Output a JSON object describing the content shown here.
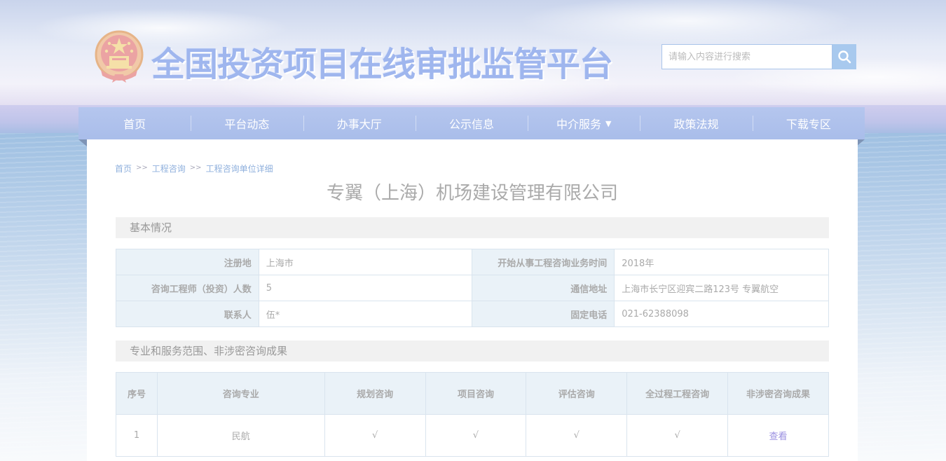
{
  "header": {
    "site_title": "全国投资项目在线审批监管平台",
    "emblem_icon": "national-emblem-icon",
    "search": {
      "placeholder": "请输入内容进行搜索",
      "icon": "search-icon"
    }
  },
  "nav": {
    "items": [
      {
        "label": "首页"
      },
      {
        "label": "平台动态"
      },
      {
        "label": "办事大厅"
      },
      {
        "label": "公示信息"
      },
      {
        "label": "中介服务",
        "caret": "▼"
      },
      {
        "label": "政策法规"
      },
      {
        "label": "下载专区"
      }
    ]
  },
  "breadcrumb": {
    "items": [
      "首页",
      "工程咨询",
      "工程咨询单位详细"
    ],
    "separator": ">>"
  },
  "company_name": "专翼（上海）机场建设管理有限公司",
  "basic_info": {
    "section_title": "基本情况",
    "rows": [
      {
        "label1": "注册地",
        "value1": "上海市",
        "label2": "开始从事工程咨询业务时间",
        "value2": "2018年"
      },
      {
        "label1": "咨询工程师（投资）人数",
        "value1": "5",
        "label2": "通信地址",
        "value2": "上海市长宁区迎宾二路123号 专翼航空"
      },
      {
        "label1": "联系人",
        "value1": "伍*",
        "label2": "固定电话",
        "value2": "021-62388098"
      }
    ]
  },
  "services": {
    "section_title": "专业和服务范围、非涉密咨询成果",
    "headers": [
      "序号",
      "咨询专业",
      "规划咨询",
      "项目咨询",
      "评估咨询",
      "全过程工程咨询",
      "非涉密咨询成果"
    ],
    "rows": [
      {
        "index": "1",
        "specialty": "民航",
        "planning": "√",
        "project": "√",
        "assessment": "√",
        "whole_process": "√",
        "results_link": "查看"
      }
    ]
  },
  "colors": {
    "nav_bg": "#aabdea",
    "title_blue": "#9fb6ee",
    "label_bg": "#eaf2f8",
    "link_purple": "#9a8fe0"
  }
}
